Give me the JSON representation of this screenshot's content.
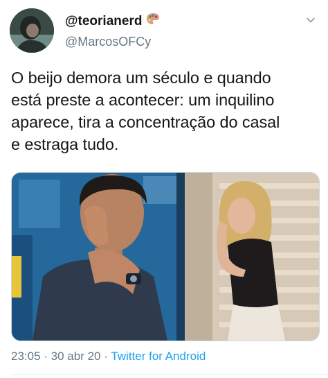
{
  "tweet": {
    "display_name": "@teorianerd",
    "handle": "@MarcosOFCy",
    "text_lines": [
      "O beijo demora um século e quando",
      "está preste a acontecer: um inquilino",
      "aparece, tira a concentração do casal",
      "e estraga tudo."
    ],
    "time": "23:05",
    "separator": " · ",
    "date": "30 abr 20",
    "source": "Twitter for Android"
  },
  "icons": {
    "name_emoji": "artist-palette-icon",
    "menu": "chevron-down-icon"
  },
  "colors": {
    "text": "#14171a",
    "secondary": "#657786",
    "link": "#1da1f2"
  }
}
